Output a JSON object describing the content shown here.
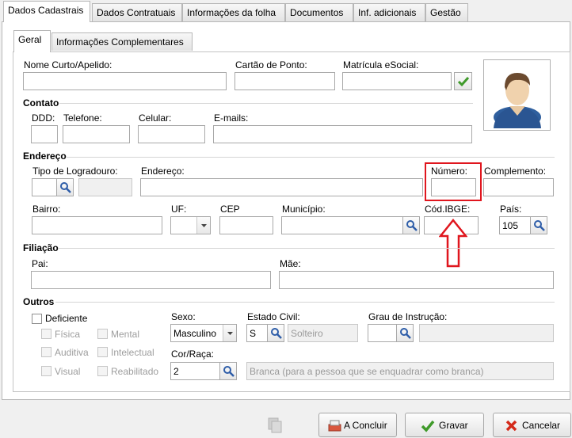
{
  "tabs": [
    "Dados Cadastrais",
    "Dados Contratuais",
    "Informações da folha",
    "Documentos",
    "Inf. adicionais",
    "Gestão"
  ],
  "subtabs": [
    "Geral",
    "Informações Complementares"
  ],
  "fields": {
    "nome_curto": {
      "label": "Nome Curto/Apelido:",
      "value": ""
    },
    "cartao_ponto": {
      "label": "Cartão de Ponto:",
      "value": ""
    },
    "matricula_esocial": {
      "label": "Matrícula eSocial:",
      "value": ""
    }
  },
  "contato": {
    "title": "Contato",
    "ddd": "DDD:",
    "telefone": "Telefone:",
    "celular": "Celular:",
    "emails": "E-mails:"
  },
  "endereco": {
    "title": "Endereço",
    "tipo_logradouro": "Tipo de Logradouro:",
    "endereco": "Endereço:",
    "numero": "Número:",
    "complemento": "Complemento:",
    "bairro": "Bairro:",
    "uf": "UF:",
    "cep": "CEP",
    "municipio": "Município:",
    "cod_ibge": "Cód.IBGE:",
    "pais": "País:",
    "pais_value": "105"
  },
  "filiacao": {
    "title": "Filiação",
    "pai": "Pai:",
    "mae": "Mãe:"
  },
  "outros": {
    "title": "Outros",
    "deficiente": "Deficiente",
    "fisica": "Física",
    "mental": "Mental",
    "auditiva": "Auditiva",
    "intelectual": "Intelectual",
    "visual": "Visual",
    "reabilitado": "Reabilitado",
    "sexo_label": "Sexo:",
    "sexo_value": "Masculino",
    "estado_civil_label": "Estado Civil:",
    "estado_civil_code": "S",
    "estado_civil_desc": "Solteiro",
    "grau_instrucao_label": "Grau de Instrução:",
    "cor_raca_label": "Cor/Raça:",
    "cor_raca_code": "2",
    "cor_raca_desc": "Branca (para a pessoa que se enquadrar como branca)"
  },
  "buttons": {
    "concluir": "A Concluir",
    "gravar": "Gravar",
    "cancelar": "Cancelar"
  },
  "colors": {
    "highlight": "#e0161e",
    "ok_green": "#3f9a2a",
    "cancel_red": "#d42a1a"
  }
}
